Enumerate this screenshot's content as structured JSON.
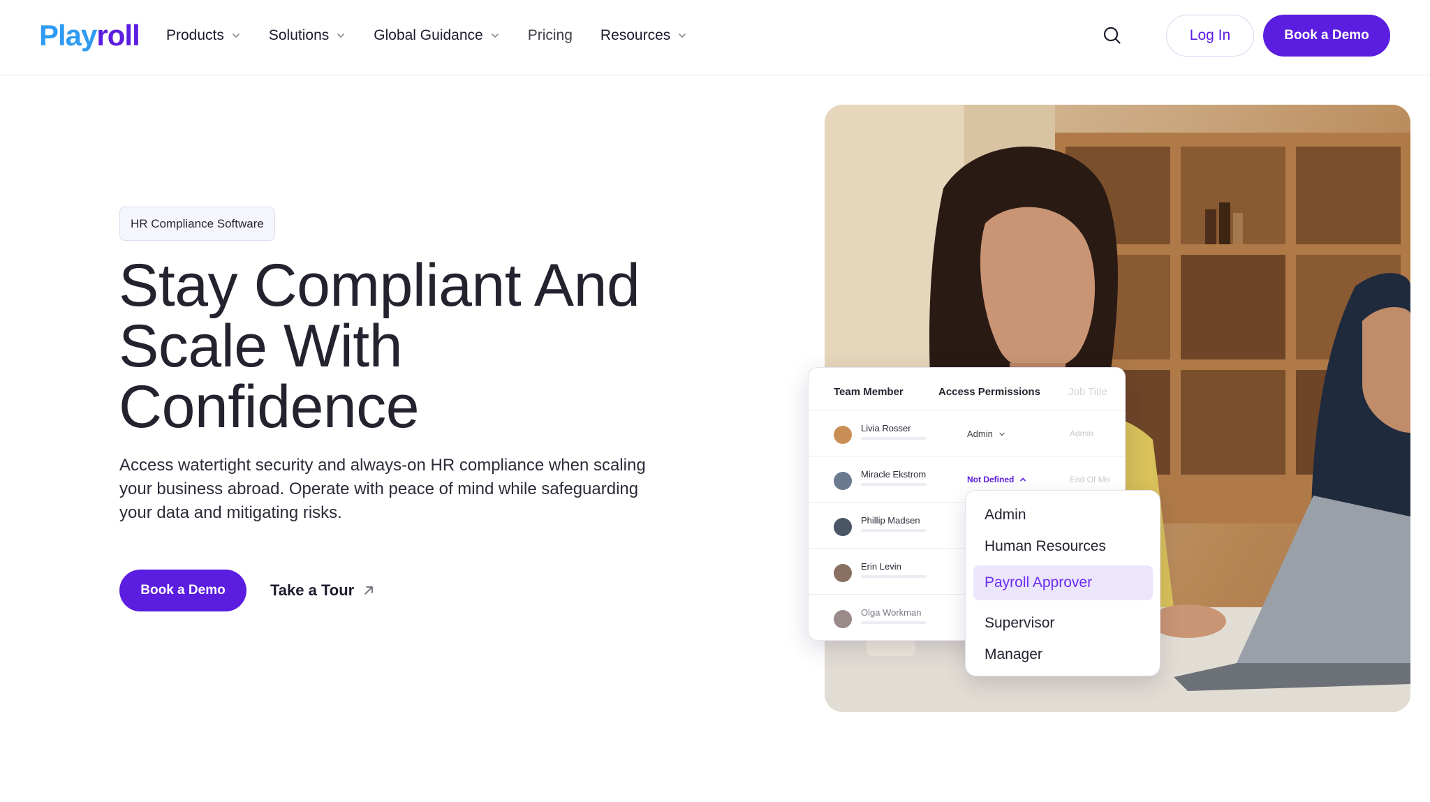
{
  "header": {
    "logo_part1": "Play",
    "logo_part2": "roll",
    "nav": [
      {
        "label": "Products",
        "has_dropdown": true
      },
      {
        "label": "Solutions",
        "has_dropdown": true
      },
      {
        "label": "Global Guidance",
        "has_dropdown": true
      },
      {
        "label": "Pricing",
        "has_dropdown": false
      },
      {
        "label": "Resources",
        "has_dropdown": true
      }
    ],
    "search_icon": "search-icon",
    "login_label": "Log In",
    "demo_label": "Book a Demo"
  },
  "hero": {
    "tag": "HR Compliance Software",
    "title_lines": [
      "Stay Compliant And",
      "Scale With",
      "Confidence"
    ],
    "description_lines": [
      "Access watertight security and always-on HR compliance when scaling",
      "your business abroad. Operate with peace of mind while safeguarding",
      "your data and mitigating risks."
    ],
    "primary_cta": "Book a Demo",
    "secondary_cta": "Take a Tour",
    "secondary_icon": "arrow-up-right-icon"
  },
  "table": {
    "headers": [
      "Team Member",
      "Access Permissions",
      "Job Title"
    ],
    "rows": [
      {
        "name": "Livia Rosser",
        "permission": "Admin",
        "job": "Admin",
        "avatar_color": "#c98e56"
      },
      {
        "name": "Miracle Ekstrom",
        "permission": "Not Defined",
        "job": "End Of Mo",
        "avatar_color": "#6b7a8f"
      },
      {
        "name": "Phillip Madsen",
        "permission": "",
        "job": "",
        "avatar_color": "#4a5566"
      },
      {
        "name": "Erin Levin",
        "permission": "",
        "job": "",
        "avatar_color": "#8a6f63"
      },
      {
        "name": "Olga Workman",
        "permission": "",
        "job": "",
        "avatar_color": "#9a8a8a"
      }
    ]
  },
  "dropdown": {
    "options": [
      "Admin",
      "Human Resources",
      "Payroll Approver",
      "Supervisor",
      "Manager"
    ],
    "selected": "Payroll Approver"
  },
  "colors": {
    "brand_purple": "#5b1de0",
    "brand_blue": "#2f9bf2",
    "selected_bg": "#ece6fd"
  }
}
